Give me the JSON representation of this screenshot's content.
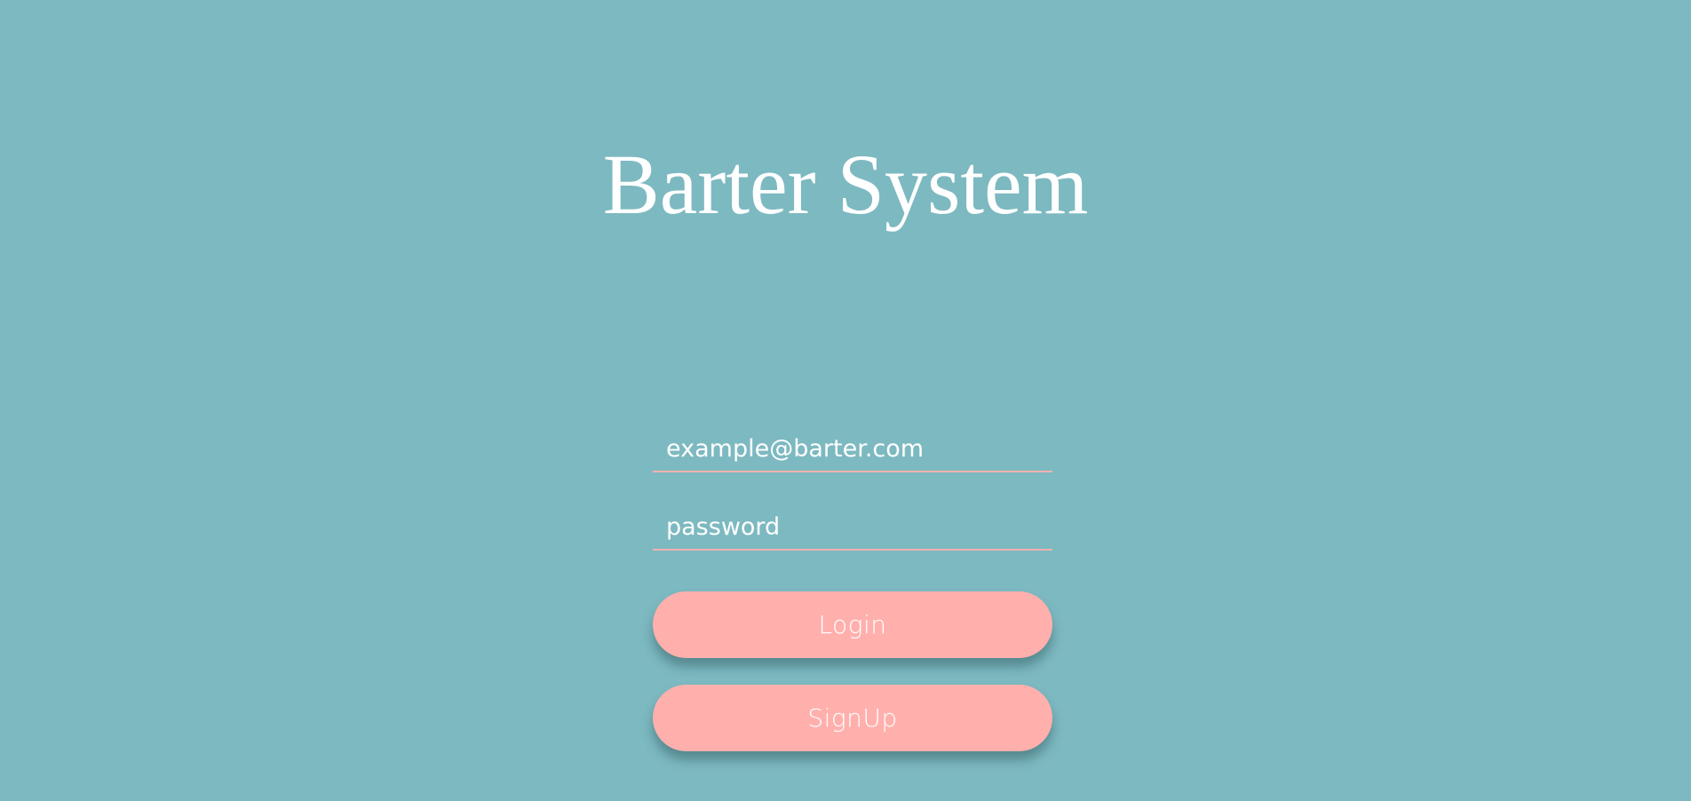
{
  "app": {
    "title": "Barter System"
  },
  "login_form": {
    "email": {
      "value": "",
      "placeholder": "example@barter.com"
    },
    "password": {
      "value": "",
      "placeholder": "password"
    },
    "login_label": "Login",
    "signup_label": "SignUp"
  },
  "colors": {
    "background": "#7db9c1",
    "button": "#ffb0ad",
    "input_underline": "#f1b2ae",
    "text": "#ffffff"
  }
}
